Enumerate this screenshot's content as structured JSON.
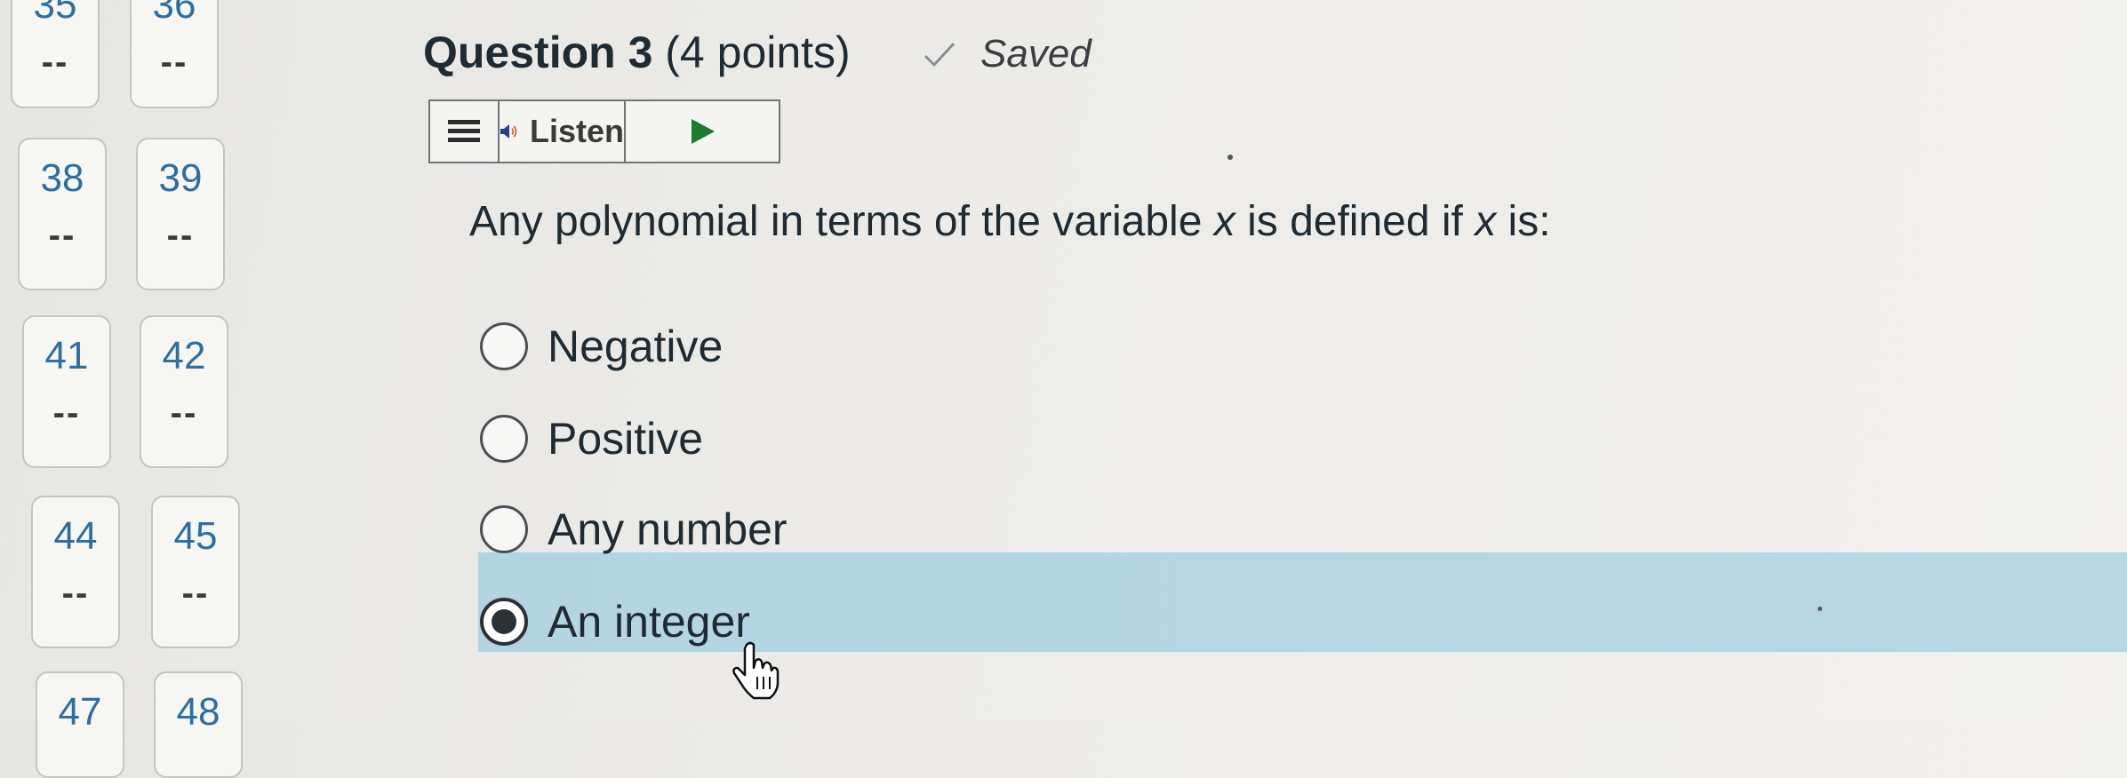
{
  "navigator": {
    "tiles": [
      {
        "num": "35",
        "status": "--"
      },
      {
        "num": "36",
        "status": "--"
      },
      {
        "num": "38",
        "status": "--"
      },
      {
        "num": "39",
        "status": "--"
      },
      {
        "num": "41",
        "status": "--"
      },
      {
        "num": "42",
        "status": "--"
      },
      {
        "num": "44",
        "status": "--"
      },
      {
        "num": "45",
        "status": "--"
      },
      {
        "num": "47",
        "status": ""
      },
      {
        "num": "48",
        "status": ""
      }
    ]
  },
  "question": {
    "title": "Question 3",
    "points": "(4 points)",
    "saved_label": "Saved",
    "text_before": "Any polynomial in terms of the variable ",
    "var1": "x",
    "text_middle": " is defined if ",
    "var2": "x",
    "text_after": " is:",
    "options": [
      {
        "label": "Negative",
        "selected": false
      },
      {
        "label": "Positive",
        "selected": false
      },
      {
        "label": "Any number",
        "selected": false
      },
      {
        "label": "An integer",
        "selected": true
      }
    ]
  },
  "toolbar": {
    "listen_label": "Listen",
    "menu_icon": "hamburger-menu-icon",
    "speaker_icon": "speaker-icon",
    "play_icon": "play-icon"
  },
  "colors": {
    "tile_number": "#2d6fa3",
    "selected_band": "#b5d6e2",
    "text": "#1f2b33"
  }
}
